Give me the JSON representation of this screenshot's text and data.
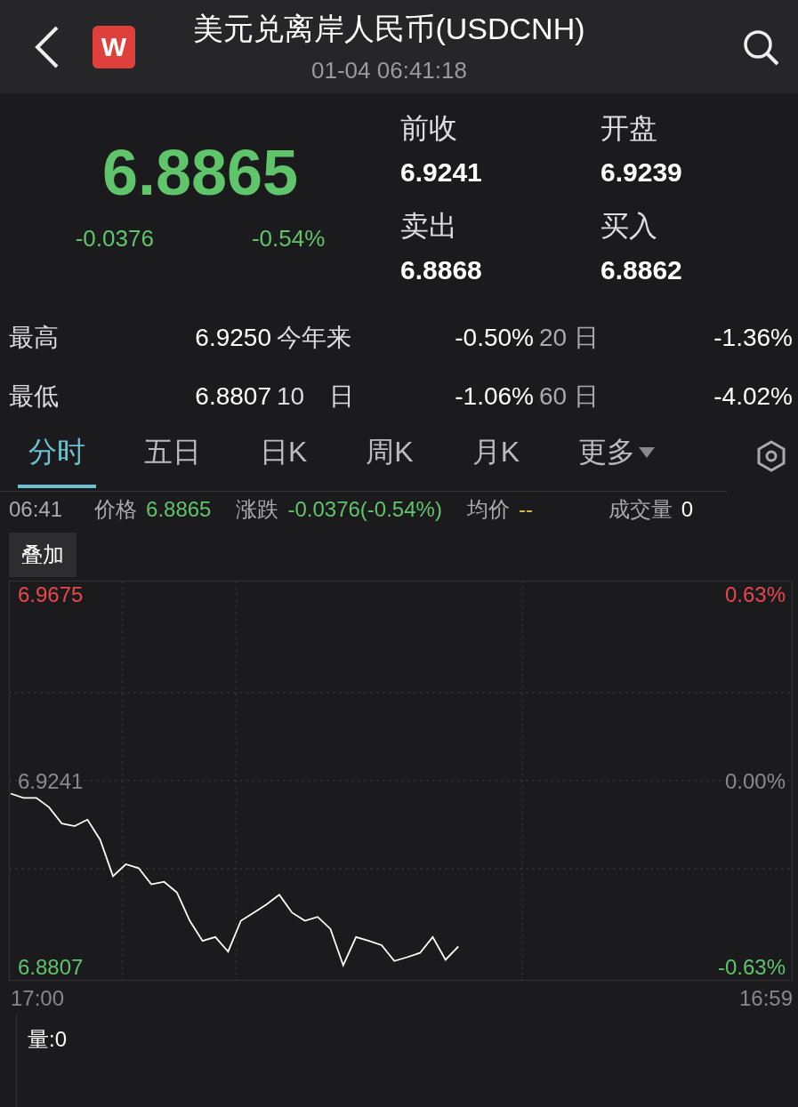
{
  "header": {
    "title": "美元兑离岸人民币(USDCNH)",
    "datetime": "01-04 06:41:18",
    "logo": "W"
  },
  "quote": {
    "price": "6.8865",
    "change": "-0.0376",
    "change_pct": "-0.54%",
    "fields": [
      {
        "label": "前收",
        "value": "6.9241"
      },
      {
        "label": "开盘",
        "value": "6.9239"
      },
      {
        "label": "卖出",
        "value": "6.8868"
      },
      {
        "label": "买入",
        "value": "6.8862"
      }
    ]
  },
  "stats": [
    {
      "label": "最高",
      "value": "6.9250",
      "label2": "今年来",
      "value2": "-0.50%",
      "label3": "20 日",
      "value3": "-1.36%"
    },
    {
      "label": "最低",
      "value": "6.8807",
      "label2": "10　日",
      "value2": "-1.06%",
      "label3": "60 日",
      "value3": "-4.02%"
    }
  ],
  "tabs": [
    {
      "label": "分时",
      "selected": true
    },
    {
      "label": "五日",
      "selected": false
    },
    {
      "label": "日K",
      "selected": false
    },
    {
      "label": "周K",
      "selected": false
    },
    {
      "label": "月K",
      "selected": false
    },
    {
      "label": "更多",
      "selected": false,
      "dropdown": true
    }
  ],
  "crosshair": {
    "time": "06:41",
    "fields": [
      {
        "label": "价格",
        "value": "6.8865",
        "color": "#5fc46a"
      },
      {
        "label": "涨跌",
        "value": "-0.0376(-0.54%)",
        "color": "#5fc46a"
      },
      {
        "label": "均价",
        "value": "--",
        "color": "#d8c24a"
      },
      {
        "label": "成交量",
        "value": "0",
        "color": "#ffffff"
      }
    ]
  },
  "overlay_button": "叠加",
  "chart": {
    "percent_labels": [
      "0.63%",
      "0.00%",
      "-0.63%"
    ],
    "time_labels": [
      "17:00",
      "16:59"
    ],
    "chart_data": {
      "type": "line",
      "ylim": [
        6.8774,
        6.9708
      ],
      "yticks": [
        {
          "value": 6.9675,
          "label": "6.9675"
        },
        {
          "value": 6.9241,
          "label": "6.9241"
        },
        {
          "value": 6.8807,
          "label": "6.8807"
        }
      ],
      "categories": [
        null,
        null,
        null,
        null,
        null,
        null,
        null,
        null,
        null,
        null,
        null,
        null,
        null,
        null,
        null,
        null,
        null,
        null,
        null,
        null,
        null,
        null,
        null,
        null,
        null,
        null,
        null,
        null,
        null,
        null,
        null,
        null,
        null,
        null,
        null,
        null,
        null,
        null,
        null,
        null,
        null,
        null,
        null,
        null,
        null,
        null,
        null,
        null,
        null,
        null,
        null,
        null,
        null,
        null,
        null,
        null,
        null,
        null,
        null,
        null,
        null,
        null
      ],
      "series": [
        {
          "color": "#ffffff",
          "values": [
            6.9211,
            6.9201,
            6.9201,
            6.9179,
            6.9141,
            6.9135,
            6.915,
            6.9103,
            6.9018,
            6.9046,
            6.9037,
            6.8999,
            6.9005,
            6.898,
            6.8914,
            6.8867,
            6.8876,
            6.8842,
            6.8914,
            6.8933,
            6.8952,
            6.8975,
            6.8933,
            6.8914,
            6.8923,
            6.8895,
            6.881,
            6.8876,
            6.8867,
            6.8857,
            6.882,
            6.8829,
            6.8839,
            6.8876,
            6.8823,
            6.8854,
            null,
            null,
            null,
            null,
            null,
            null,
            null,
            null,
            null,
            null,
            null,
            null,
            null,
            null,
            null,
            null,
            null,
            null,
            null,
            null,
            null,
            null,
            null,
            null,
            null,
            null
          ]
        }
      ]
    }
  },
  "volume": {
    "label": "量:0"
  }
}
